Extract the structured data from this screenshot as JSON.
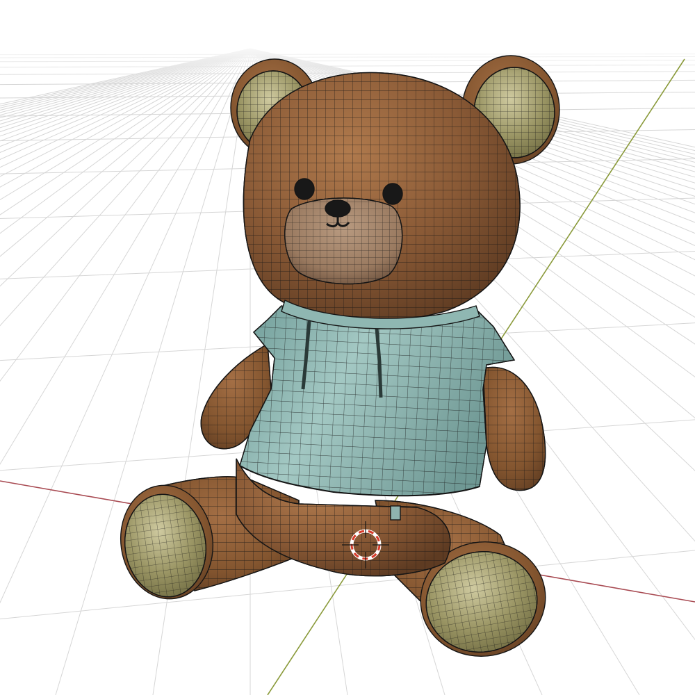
{
  "viewport": {
    "mode": "wireframe-overlay",
    "background": "#ffffff",
    "grid_color": "#d6d6d6",
    "x_axis_color": "#a84a52",
    "y_axis_color": "#8a9a3a",
    "wire_color": "#151515"
  },
  "object": {
    "name": "teddy-bear",
    "colors": {
      "fur": "#8a5a36",
      "fur_light": "#a9744a",
      "fur_dark": "#5a3920",
      "inner": "#8e8858",
      "inner_light": "#c2bd92",
      "muzzle": "#a0826a",
      "shirt": "#7fa8a4",
      "shirt_light": "#9cc2bd",
      "shirt_dark": "#5c8782",
      "eye": "#181818"
    }
  },
  "cursor_3d": {
    "outer": "#d83b2a",
    "inner": "#ffffff"
  }
}
